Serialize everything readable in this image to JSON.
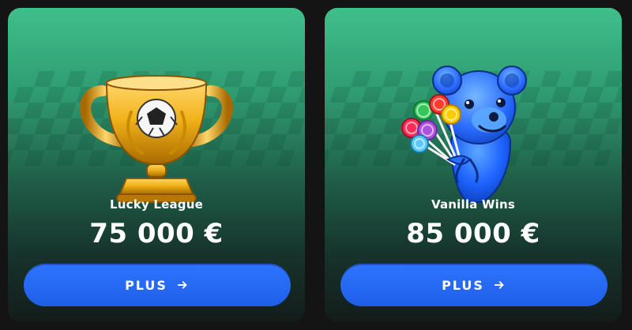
{
  "cards": [
    {
      "title": "Lucky League",
      "amount": "75 000 €",
      "button_label": "PLUS",
      "button_icon": "arrow-right-icon",
      "art_icon": "trophy-soccer-ball-icon"
    },
    {
      "title": "Vanilla Wins",
      "amount": "85 000 €",
      "button_label": "PLUS",
      "button_icon": "arrow-right-icon",
      "art_icon": "blue-gummy-bear-lollipops-icon"
    }
  ],
  "colors": {
    "card_top": "#3fbf8a",
    "card_bottom": "#141c1a",
    "button": "#2d74ff",
    "text": "#ffffff"
  }
}
